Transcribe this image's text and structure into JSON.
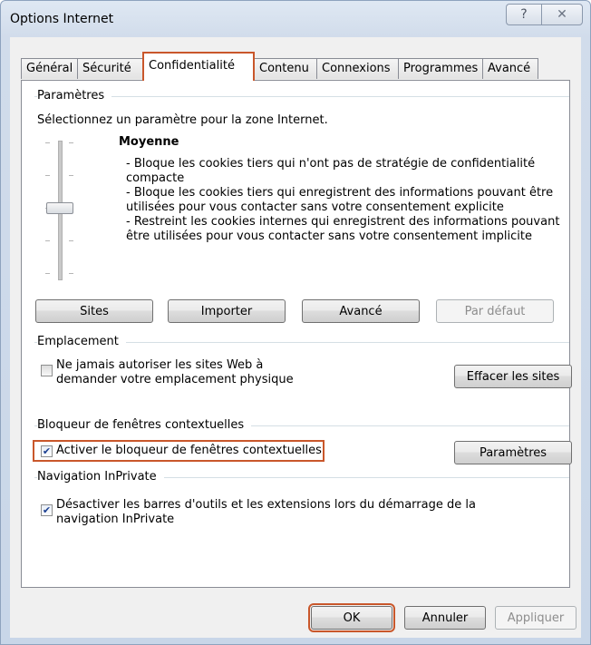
{
  "window": {
    "title": "Options Internet",
    "help_glyph": "?",
    "close_glyph": "✕"
  },
  "tabs": [
    {
      "label": "Général"
    },
    {
      "label": "Sécurité"
    },
    {
      "label": "Confidentialité",
      "active": true
    },
    {
      "label": "Contenu"
    },
    {
      "label": "Connexions"
    },
    {
      "label": "Programmes"
    },
    {
      "label": "Avancé"
    }
  ],
  "settings": {
    "group_label": "Paramètres",
    "instruction": "Sélectionnez un paramètre pour la zone Internet.",
    "level_name": "Moyenne",
    "slider_level": "Moyenne",
    "description_lines": [
      "- Bloque les cookies tiers qui n'ont pas de stratégie de confidentialité",
      "compacte",
      "- Bloque les cookies tiers qui enregistrent des informations pouvant être",
      "utilisées pour vous contacter sans votre consentement explicite",
      "- Restreint les cookies internes qui enregistrent des informations pouvant",
      "être utilisées pour vous contacter sans votre consentement implicite"
    ],
    "buttons": {
      "sites": "Sites",
      "import": "Importer",
      "advanced": "Avancé",
      "default": "Par défaut"
    }
  },
  "location": {
    "group_label": "Emplacement",
    "checkbox_line1": "Ne jamais autoriser les sites Web à",
    "checkbox_line2": "demander votre emplacement physique",
    "checked": false,
    "clear_button": "Effacer les sites"
  },
  "popup": {
    "group_label": "Bloqueur de fenêtres contextuelles",
    "checkbox_label": "Activer le bloqueur de fenêtres contextuelles",
    "checked": true,
    "settings_button": "Paramètres"
  },
  "inprivate": {
    "group_label": "Navigation InPrivate",
    "checkbox_line1": "Désactiver les barres d'outils et les extensions lors du démarrage de la",
    "checkbox_line2": "navigation InPrivate",
    "checked": true
  },
  "footer": {
    "ok": "OK",
    "cancel": "Annuler",
    "apply": "Appliquer"
  },
  "colors": {
    "highlight": "#c9572b",
    "check": "#1b3f91"
  },
  "icons": {
    "check_glyph": "✔"
  }
}
